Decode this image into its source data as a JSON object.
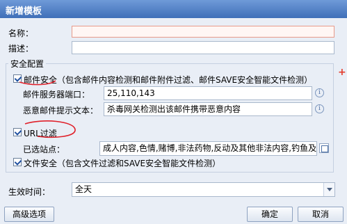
{
  "dialog": {
    "title": "新增模板"
  },
  "form": {
    "name_label": "名称：",
    "name_value": "",
    "desc_label": "描述：",
    "desc_value": "",
    "section_title": "安全配置",
    "mail": {
      "checkbox_label": "邮件安全（包含邮件内容检测和邮件附件过滤、邮件SAVE安全智能文件检测）",
      "checked": true,
      "port_label": "邮件服务器端口：",
      "port_value": "25,110,143",
      "malicious_label": "恶意邮件提示文本：",
      "malicious_value": "杀毒网关检测出该邮件携带恶意内容"
    },
    "url": {
      "checkbox_label": "URL过滤",
      "checked": true,
      "selected_label": "已选站点：",
      "selected_value": "成人内容,色情,赌博,非法药物,反动及其他非法内容,钓鱼及恶意网站"
    },
    "file": {
      "checkbox_label": "文件安全（包含文件过滤和SAVE安全智能文件检测）",
      "checked": true
    },
    "effective_label": "生效时间：",
    "effective_value": "全天",
    "required_mark": "+"
  },
  "buttons": {
    "advanced": "高级选项",
    "ok": "确定",
    "cancel": "取消"
  },
  "icons": {
    "info": "i"
  },
  "colors": {
    "annotation": "#e0202a",
    "required": "#e43b2b"
  }
}
